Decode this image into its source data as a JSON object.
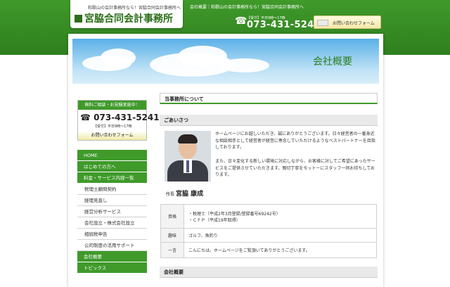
{
  "header": {
    "tagline": "和歌山の会計事務所なら！宮脇合同会計事務所へ",
    "logo_text": "宮脇合同会計事務所",
    "breadcrumb": "会社概要｜和歌山の会計事務所なら！宮脇合同会計事務所へ",
    "phone_hours": "【受付】平日9時〜17時",
    "phone": "073-431-5241",
    "contact_button": "お問い合わせフォーム"
  },
  "hero": {
    "title": "会社概要"
  },
  "sidebar": {
    "contact_header": "無料ご相談・お見積実施中！",
    "phone": "073-431-5241",
    "hours": "【受付】平日9時〜17時",
    "form_link": "お問い合わせフォーム",
    "nav": [
      {
        "label": "HOME",
        "type": "main"
      },
      {
        "label": "はじめての方へ",
        "type": "main"
      },
      {
        "label": "料金・サービス内容一覧",
        "type": "main"
      },
      {
        "label": "税理士顧問契約",
        "type": "sub"
      },
      {
        "label": "経理見直し",
        "type": "sub"
      },
      {
        "label": "経営分析サービス",
        "type": "sub"
      },
      {
        "label": "会社設立・株式会社設立",
        "type": "sub"
      },
      {
        "label": "相続税申告",
        "type": "sub"
      },
      {
        "label": "公的制度の活用サポート",
        "type": "sub"
      },
      {
        "label": "会社概要",
        "type": "main"
      },
      {
        "label": "トピックス",
        "type": "main"
      }
    ]
  },
  "main": {
    "section_title": "当事務所について",
    "greeting_title": "ごあいさつ",
    "greeting_p1": "ホームページにお越しいただき、誠にありがとうございます。日々経営者の一番身近な相談相手として経営者が経営に専念していただけるようなベストパートナーを目指しております。",
    "greeting_p2": "また、日々変化する新しい環境に対応しながら、お客様に対してご希望にあったサービスをご提供させていただきます。親切丁寧をモットーにスタッフ一同お待ちしております。",
    "signature_title": "所長",
    "signature_name": "宮脇 康成",
    "info": {
      "qual_label": "資格",
      "qual_1": "・税理士（平成2年3月登録/登録番号69242号）",
      "qual_2": "・ＣＦＰ（平成19年取得）",
      "hobby_label": "趣味",
      "hobby": "ゴルフ、魚釣り",
      "word_label": "一言",
      "word": "こんにちは。ホームページをご覧頂いてありがとうございます。"
    },
    "overview_title": "会社概要"
  }
}
